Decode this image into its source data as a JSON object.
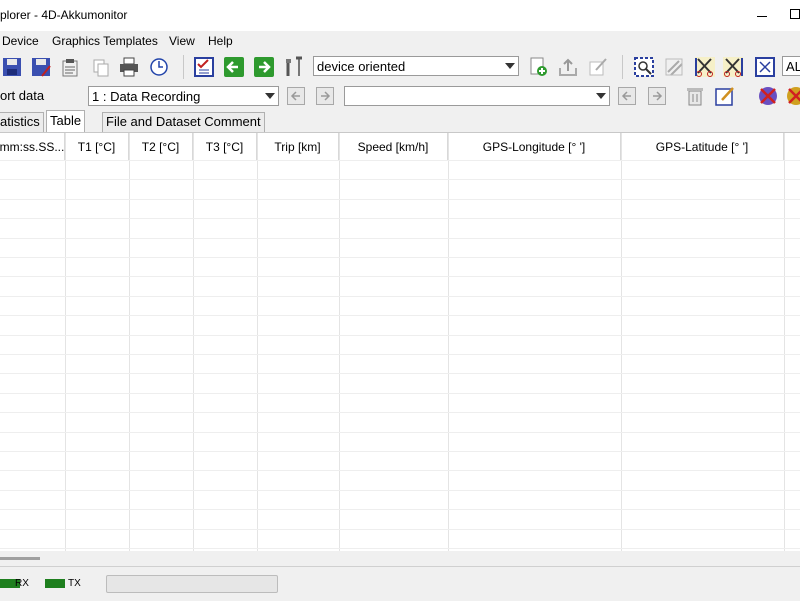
{
  "window": {
    "title": "plorer  -  4D-Akkumonitor"
  },
  "menu": [
    "Device",
    "Graphics Templates",
    "View",
    "Help"
  ],
  "toolbar": {
    "view_mode": "device oriented",
    "all_label": "AL"
  },
  "toolbar2": {
    "port_label": "ort data",
    "record_select": "1 : Data Recording",
    "comment_select": ""
  },
  "tabs": [
    "atistics",
    "Table",
    "File and Dataset Comment"
  ],
  "table": {
    "columns": [
      "mm:ss.SS...",
      "T1 [°C]",
      "T2 [°C]",
      "T3 [°C]",
      "Trip [km]",
      "Speed [km/h]",
      "GPS-Longitude [° ']",
      "GPS-Latitude [° ']"
    ],
    "rows": []
  },
  "status": {
    "rx": "RX",
    "tx": "TX",
    "progress": 0
  },
  "colors": {
    "led": "#1e7f1e",
    "nav_green": "#2e9a2e"
  }
}
